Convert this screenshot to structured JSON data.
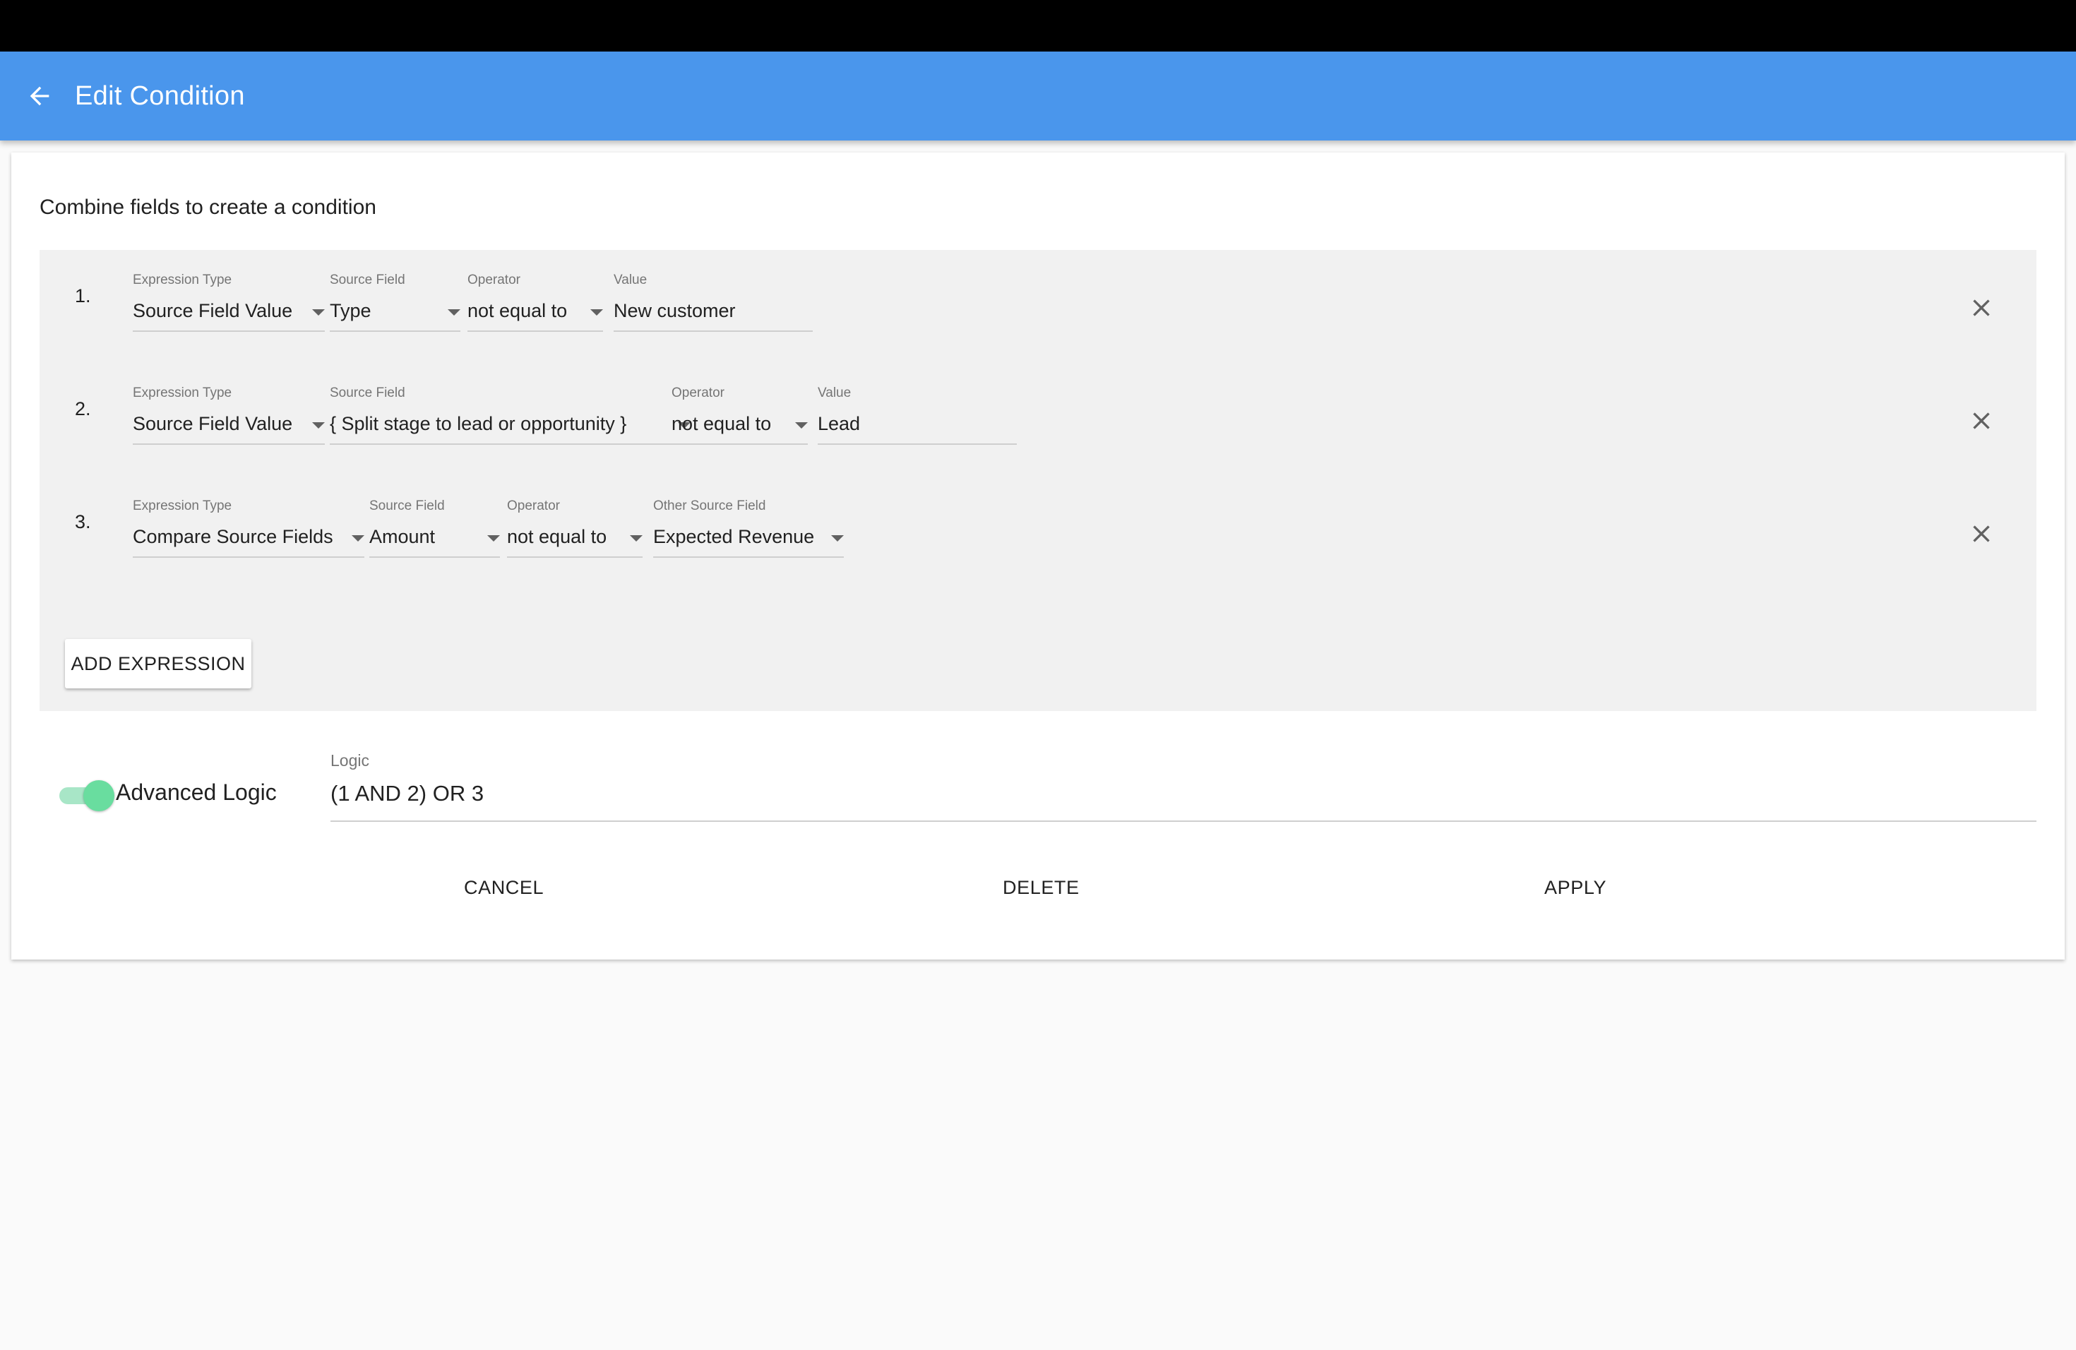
{
  "appbar": {
    "title": "Edit Condition"
  },
  "card": {
    "heading": "Combine fields to create a condition"
  },
  "expressions": [
    {
      "number": "1.",
      "fields": [
        {
          "label": "Expression Type",
          "value": "Source Field Value"
        },
        {
          "label": "Source Field",
          "value": "Type"
        },
        {
          "label": "Operator",
          "value": "not equal to"
        },
        {
          "label": "Value",
          "value": "New customer"
        }
      ]
    },
    {
      "number": "2.",
      "fields": [
        {
          "label": "Expression Type",
          "value": "Source Field Value"
        },
        {
          "label": "Source Field",
          "value": "{ Split stage to lead or opportunity }"
        },
        {
          "label": "Operator",
          "value": "not equal to"
        },
        {
          "label": "Value",
          "value": "Lead"
        }
      ]
    },
    {
      "number": "3.",
      "fields": [
        {
          "label": "Expression Type",
          "value": "Compare Source Fields"
        },
        {
          "label": "Source Field",
          "value": "Amount"
        },
        {
          "label": "Operator",
          "value": "not equal to"
        },
        {
          "label": "Other Source Field",
          "value": "Expected Revenue"
        }
      ]
    }
  ],
  "add_expression_label": "ADD EXPRESSION",
  "advanced_logic": {
    "label": "Advanced Logic",
    "enabled": true,
    "color": "#69dd9f"
  },
  "logic": {
    "label": "Logic",
    "value": "(1 AND 2) OR 3"
  },
  "actions": {
    "cancel": "CANCEL",
    "delete": "DELETE",
    "apply": "APPLY"
  },
  "colors": {
    "appbar": "#4a96ec",
    "expression_panel": "#f1f1f1"
  },
  "icons": {
    "back": "arrow-left-icon",
    "remove": "close-icon",
    "dropdown": "caret-down-icon"
  }
}
